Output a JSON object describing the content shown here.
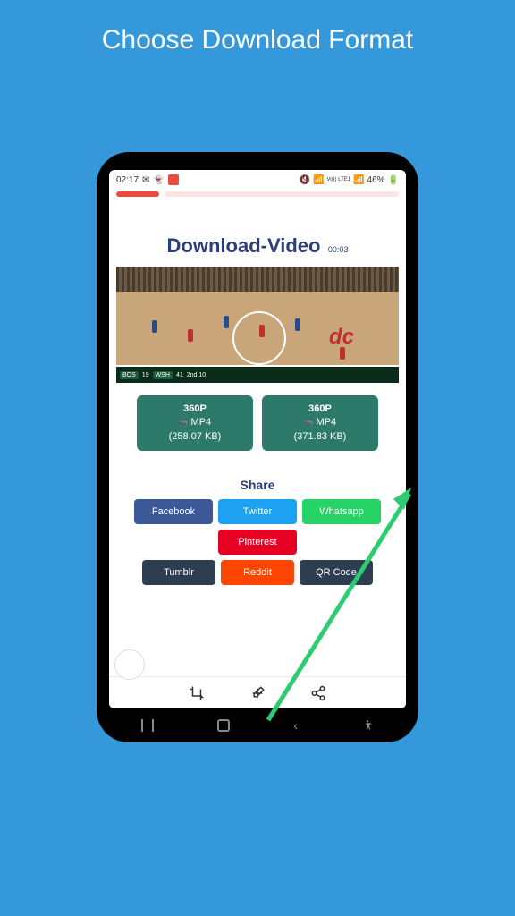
{
  "page": {
    "title": "Choose Download Format"
  },
  "status": {
    "time": "02:17",
    "battery": "46%",
    "net": "Vo)) LTE1"
  },
  "download": {
    "title": "Download-Video",
    "duration": "00:03"
  },
  "scorebar": {
    "team1": "BOS",
    "score1": "19",
    "team2": "WSH",
    "score2": "41",
    "period": "2nd 10"
  },
  "court_logo": "dc",
  "formats": [
    {
      "res": "360P",
      "type": "MP4",
      "size": "(258.07 KB)"
    },
    {
      "res": "360P",
      "type": "MP4",
      "size": "(371.83 KB)"
    }
  ],
  "share": {
    "title": "Share",
    "buttons": {
      "facebook": "Facebook",
      "twitter": "Twitter",
      "whatsapp": "Whatsapp",
      "pinterest": "Pinterest",
      "tumblr": "Tumblr",
      "reddit": "Reddit",
      "qrcode": "QR Code"
    }
  }
}
